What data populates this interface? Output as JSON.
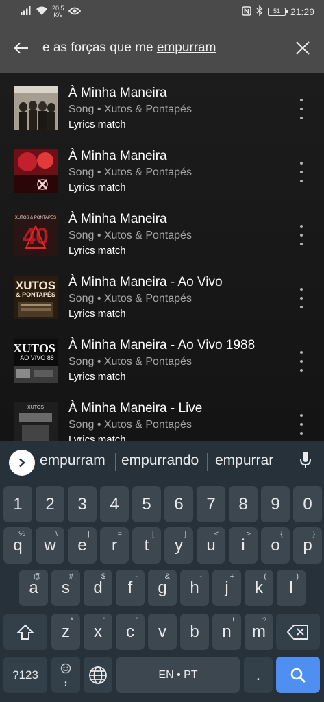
{
  "status_bar": {
    "net_speed_value": "20,5",
    "net_speed_unit": "K/s",
    "battery_level": "51",
    "time": "21:29"
  },
  "search": {
    "query_prefix": "e as forças que me ",
    "query_underlined": "empurram"
  },
  "results": [
    {
      "title": "À Minha Maneira",
      "subtitle": "Song • Xutos & Pontapés",
      "match": "Lyrics match"
    },
    {
      "title": "À Minha Maneira",
      "subtitle": "Song • Xutos & Pontapés",
      "match": "Lyrics match"
    },
    {
      "title": "À Minha Maneira",
      "subtitle": "Song • Xutos & Pontapés",
      "match": "Lyrics match"
    },
    {
      "title": "À Minha Maneira - Ao Vivo",
      "subtitle": "Song • Xutos & Pontapés",
      "match": "Lyrics match"
    },
    {
      "title": "À Minha Maneira - Ao Vivo 1988",
      "subtitle": "Song • Xutos & Pontapés",
      "match": "Lyrics match"
    },
    {
      "title": "À Minha Maneira - Live",
      "subtitle": "Song • Xutos & Pontapés",
      "match": "Lyrics match"
    }
  ],
  "album_art_text": {
    "art3": "XUTOS & PONTAPÉS",
    "art4_line1": "XUTOS",
    "art4_line2": "& PONTAPÉS",
    "art5_line1": "XUTOS",
    "art5_line2": "AO VIVO 88",
    "art6": "XUTOS"
  },
  "keyboard": {
    "suggestions": [
      "empurram",
      "empurrando",
      "empurrar"
    ],
    "number_row": [
      "1",
      "2",
      "3",
      "4",
      "5",
      "6",
      "7",
      "8",
      "9",
      "0"
    ],
    "row1": [
      {
        "k": "q",
        "h": "%"
      },
      {
        "k": "w",
        "h": "\\"
      },
      {
        "k": "e",
        "h": "|"
      },
      {
        "k": "r",
        "h": "="
      },
      {
        "k": "t",
        "h": "["
      },
      {
        "k": "y",
        "h": "]"
      },
      {
        "k": "u",
        "h": "<"
      },
      {
        "k": "i",
        "h": ">"
      },
      {
        "k": "o",
        "h": "{"
      },
      {
        "k": "p",
        "h": "}"
      }
    ],
    "row2": [
      {
        "k": "a",
        "h": "@"
      },
      {
        "k": "s",
        "h": "#"
      },
      {
        "k": "d",
        "h": "$"
      },
      {
        "k": "f",
        "h": "-"
      },
      {
        "k": "g",
        "h": "&"
      },
      {
        "k": "h",
        "h": "-"
      },
      {
        "k": "j",
        "h": "+"
      },
      {
        "k": "k",
        "h": "("
      },
      {
        "k": "l",
        "h": ")"
      }
    ],
    "row3": [
      {
        "k": "z",
        "h": "*"
      },
      {
        "k": "x",
        "h": "\""
      },
      {
        "k": "c",
        "h": "'"
      },
      {
        "k": "v",
        "h": ":"
      },
      {
        "k": "b",
        "h": ";"
      },
      {
        "k": "n",
        "h": "!"
      },
      {
        "k": "m",
        "h": "?"
      }
    ],
    "symbols_label": "?123",
    "comma": ",",
    "space_label": "EN • PT",
    "period": "."
  }
}
